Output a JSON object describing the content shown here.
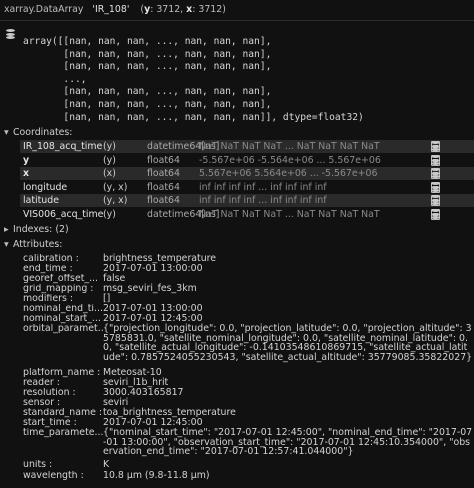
{
  "header": {
    "type_label": "xarray.DataArray",
    "var_name": "'IR_108'",
    "dims_open": "(",
    "dim_y": "y",
    "dim_y_size": ": 3712,",
    "dim_x": "x",
    "dim_x_size": ": 3712)"
  },
  "array_repr": [
    "array([[nan, nan, nan, ..., nan, nan, nan],",
    "       [nan, nan, nan, ..., nan, nan, nan],",
    "       [nan, nan, nan, ..., nan, nan, nan],",
    "       ...,",
    "       [nan, nan, nan, ..., nan, nan, nan],",
    "       [nan, nan, nan, ..., nan, nan, nan],",
    "       [nan, nan, nan, ..., nan, nan, nan]], dtype=float32)"
  ],
  "sections": {
    "coordinates": "Coordinates:",
    "indexes": "Indexes:",
    "indexes_count": "(2)",
    "attributes": "Attributes:"
  },
  "coordinates": [
    {
      "name": "IR_108_acq_time",
      "dims": "(y)",
      "dtype": "datetime64[ns]",
      "preview": "NaT NaT NaT NaT ... NaT NaT NaT NaT"
    },
    {
      "name": "y",
      "dims": "(y)",
      "dtype": "float64",
      "preview": "-5.567e+06 -5.564e+06 ... 5.567e+06"
    },
    {
      "name": "x",
      "dims": "(x)",
      "dtype": "float64",
      "preview": "5.567e+06 5.564e+06 ... -5.567e+06"
    },
    {
      "name": "longitude",
      "dims": "(y, x)",
      "dtype": "float64",
      "preview": "inf inf inf inf ... inf inf inf inf"
    },
    {
      "name": "latitude",
      "dims": "(y, x)",
      "dtype": "float64",
      "preview": "inf inf inf inf ... inf inf inf inf"
    },
    {
      "name": "VIS006_acq_time",
      "dims": "(y)",
      "dtype": "datetime64[ns]",
      "preview": "NaT NaT NaT NaT ... NaT NaT NaT NaT"
    }
  ],
  "attributes": [
    {
      "key": "calibration :",
      "value": "brightness_temperature"
    },
    {
      "key": "end_time :",
      "value": "2017-07-01 13:00:00"
    },
    {
      "key": "georef_offset_...",
      "value": "false"
    },
    {
      "key": "grid_mapping :",
      "value": "msg_seviri_fes_3km"
    },
    {
      "key": "modifiers :",
      "value": "[]"
    },
    {
      "key": "nominal_end_ti...",
      "value": "2017-07-01 13:00:00"
    },
    {
      "key": "nominal_start_...",
      "value": "2017-07-01 12:45:00"
    },
    {
      "key": "orbital_paramet...",
      "value": "{\"projection_longitude\": 0.0, \"projection_latitude\": 0.0, \"projection_altitude\": 35785831.0, \"satellite_nominal_longitude\": 0.0, \"satellite_nominal_latitude\": 0.0, \"satellite_actual_longitude\": -0.14103548610869715, \"satellite_actual_latitude\": 0.7857524055230543, \"satellite_actual_altitude\": 35779085.35822027}"
    },
    {
      "key": "platform_name :",
      "value": "Meteosat-10"
    },
    {
      "key": "reader :",
      "value": "seviri_l1b_hrit"
    },
    {
      "key": "resolution :",
      "value": "3000.403165817"
    },
    {
      "key": "sensor :",
      "value": "seviri"
    },
    {
      "key": "standard_name :",
      "value": "toa_brightness_temperature"
    },
    {
      "key": "start_time :",
      "value": "2017-07-01 12:45:00"
    },
    {
      "key": "time_paramete...",
      "value": "{\"nominal_start_time\": \"2017-07-01 12:45:00\", \"nominal_end_time\": \"2017-07-01 13:00:00\", \"observation_start_time\": \"2017-07-01 12:45:10.354000\", \"observation_end_time\": \"2017-07-01 12:57:41.044000\"}"
    },
    {
      "key": "units :",
      "value": "K"
    },
    {
      "key": "wavelength :",
      "value": "10.8 µm (9.8-11.8 µm)"
    }
  ]
}
